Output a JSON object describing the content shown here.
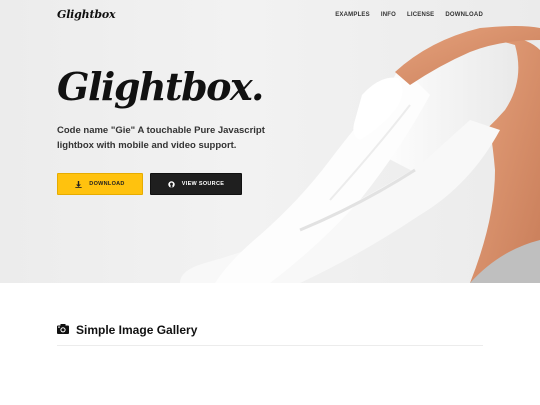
{
  "header": {
    "logo": "Glightbox",
    "nav": [
      "EXAMPLES",
      "INFO",
      "LICENSE",
      "DOWNLOAD"
    ]
  },
  "hero": {
    "title": "Glightbox.",
    "tagline": "Code name \"Gie\" A touchable Pure Javascript lightbox with mobile and video support.",
    "download_button": "DOWNLOAD",
    "source_button": "VIEW SOURCE",
    "download_icon": "download-icon",
    "source_icon": "github-icon"
  },
  "section": {
    "title": "Simple Image Gallery",
    "icon": "camera-icon"
  },
  "colors": {
    "accent": "#ffc20e",
    "dark_button": "#1f1f1f",
    "hero_bg": "#efefef"
  }
}
